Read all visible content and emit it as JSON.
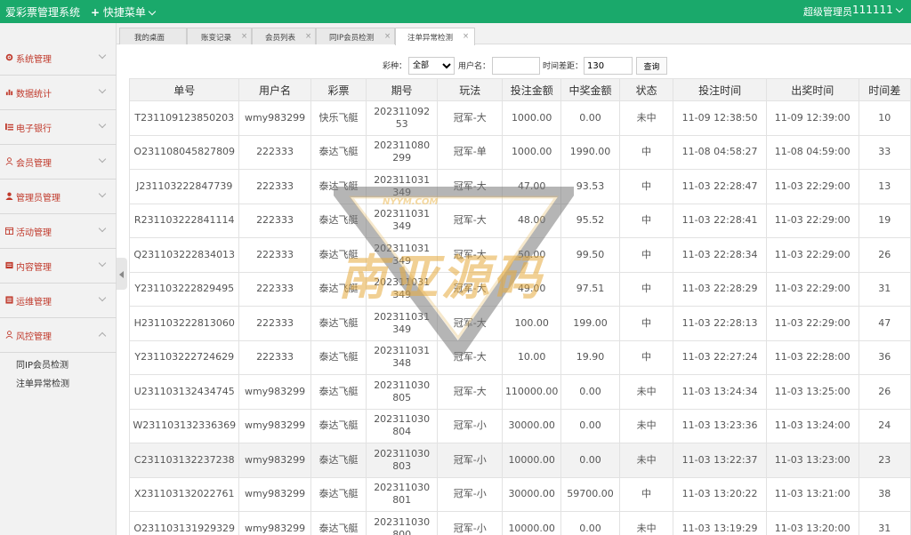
{
  "header": {
    "app_title": "爱彩票管理系统",
    "quick_menu": "快捷菜单",
    "admin_role": "超级管理员",
    "admin_user": "111111"
  },
  "sidebar": {
    "items": [
      {
        "label": "系统管理",
        "icon": "gear-icon"
      },
      {
        "label": "数据统计",
        "icon": "chart-icon"
      },
      {
        "label": "电子银行",
        "icon": "bank-icon"
      },
      {
        "label": "会员管理",
        "icon": "user-icon"
      },
      {
        "label": "管理员管理",
        "icon": "admin-icon"
      },
      {
        "label": "活动管理",
        "icon": "calendar-icon"
      },
      {
        "label": "内容管理",
        "icon": "content-icon"
      },
      {
        "label": "运维管理",
        "icon": "ops-icon"
      },
      {
        "label": "风控管理",
        "icon": "risk-icon"
      }
    ],
    "sub_items": [
      "同IP会员检测",
      "注单异常检测"
    ]
  },
  "tabs": [
    {
      "label": "我的桌面"
    },
    {
      "label": "账变记录"
    },
    {
      "label": "会员列表"
    },
    {
      "label": "同IP会员检测"
    },
    {
      "label": "注单异常检测"
    }
  ],
  "tab_close": "×",
  "filter": {
    "lottery_label": "彩种：",
    "lottery_value": "全部",
    "username_label": "用户名：",
    "username_value": "",
    "timediff_label": "时间差距：",
    "timediff_value": "130",
    "search_label": "查询"
  },
  "table": {
    "columns": [
      "单号",
      "用户名",
      "彩票",
      "期号",
      "玩法",
      "投注金额",
      "中奖金额",
      "状态",
      "投注时间",
      "出奖时间",
      "时间差"
    ],
    "rows": [
      [
        "T231109123850203",
        "wmy983299",
        "快乐飞艇",
        "20231109253",
        "冠军-大",
        "1000.00",
        "0.00",
        "未中",
        "11-09 12:38:50",
        "11-09 12:39:00",
        "10"
      ],
      [
        "O231108045827809",
        "222333",
        "泰达飞艇",
        "202311080299",
        "冠军-单",
        "1000.00",
        "1990.00",
        "中",
        "11-08 04:58:27",
        "11-08 04:59:00",
        "33"
      ],
      [
        "J231103222847739",
        "222333",
        "泰达飞艇",
        "202311031349",
        "冠军-大",
        "47.00",
        "93.53",
        "中",
        "11-03 22:28:47",
        "11-03 22:29:00",
        "13"
      ],
      [
        "R231103222841114",
        "222333",
        "泰达飞艇",
        "202311031349",
        "冠军-大",
        "48.00",
        "95.52",
        "中",
        "11-03 22:28:41",
        "11-03 22:29:00",
        "19"
      ],
      [
        "Q231103222834013",
        "222333",
        "泰达飞艇",
        "202311031349",
        "冠军-大",
        "50.00",
        "99.50",
        "中",
        "11-03 22:28:34",
        "11-03 22:29:00",
        "26"
      ],
      [
        "Y231103222829495",
        "222333",
        "泰达飞艇",
        "202311031349",
        "冠军-大",
        "49.00",
        "97.51",
        "中",
        "11-03 22:28:29",
        "11-03 22:29:00",
        "31"
      ],
      [
        "H231103222813060",
        "222333",
        "泰达飞艇",
        "202311031349",
        "冠军-大",
        "100.00",
        "199.00",
        "中",
        "11-03 22:28:13",
        "11-03 22:29:00",
        "47"
      ],
      [
        "Y231103222724629",
        "222333",
        "泰达飞艇",
        "202311031348",
        "冠军-大",
        "10.00",
        "19.90",
        "中",
        "11-03 22:27:24",
        "11-03 22:28:00",
        "36"
      ],
      [
        "U231103132434745",
        "wmy983299",
        "泰达飞艇",
        "202311030805",
        "冠军-大",
        "110000.00",
        "0.00",
        "未中",
        "11-03 13:24:34",
        "11-03 13:25:00",
        "26"
      ],
      [
        "W231103132336369",
        "wmy983299",
        "泰达飞艇",
        "202311030804",
        "冠军-小",
        "30000.00",
        "0.00",
        "未中",
        "11-03 13:23:36",
        "11-03 13:24:00",
        "24"
      ],
      [
        "C231103132237238",
        "wmy983299",
        "泰达飞艇",
        "202311030803",
        "冠军-小",
        "10000.00",
        "0.00",
        "未中",
        "11-03 13:22:37",
        "11-03 13:23:00",
        "23"
      ],
      [
        "X231103132022761",
        "wmy983299",
        "泰达飞艇",
        "202311030801",
        "冠军-小",
        "30000.00",
        "59700.00",
        "中",
        "11-03 13:20:22",
        "11-03 13:21:00",
        "38"
      ],
      [
        "O231103131929329",
        "wmy983299",
        "泰达飞艇",
        "202311030800",
        "冠军-小",
        "10000.00",
        "0.00",
        "未中",
        "11-03 13:19:29",
        "11-03 13:20:00",
        "31"
      ]
    ],
    "highlight_row": 10
  },
  "watermark": {
    "main": "南亚源码",
    "small": "NYYM.COM"
  },
  "colors": {
    "header_bg": "#1aa96b",
    "sidebar_label": "#c0392b",
    "status_lose": "#e02020",
    "status_win": "#1a9a3a"
  }
}
